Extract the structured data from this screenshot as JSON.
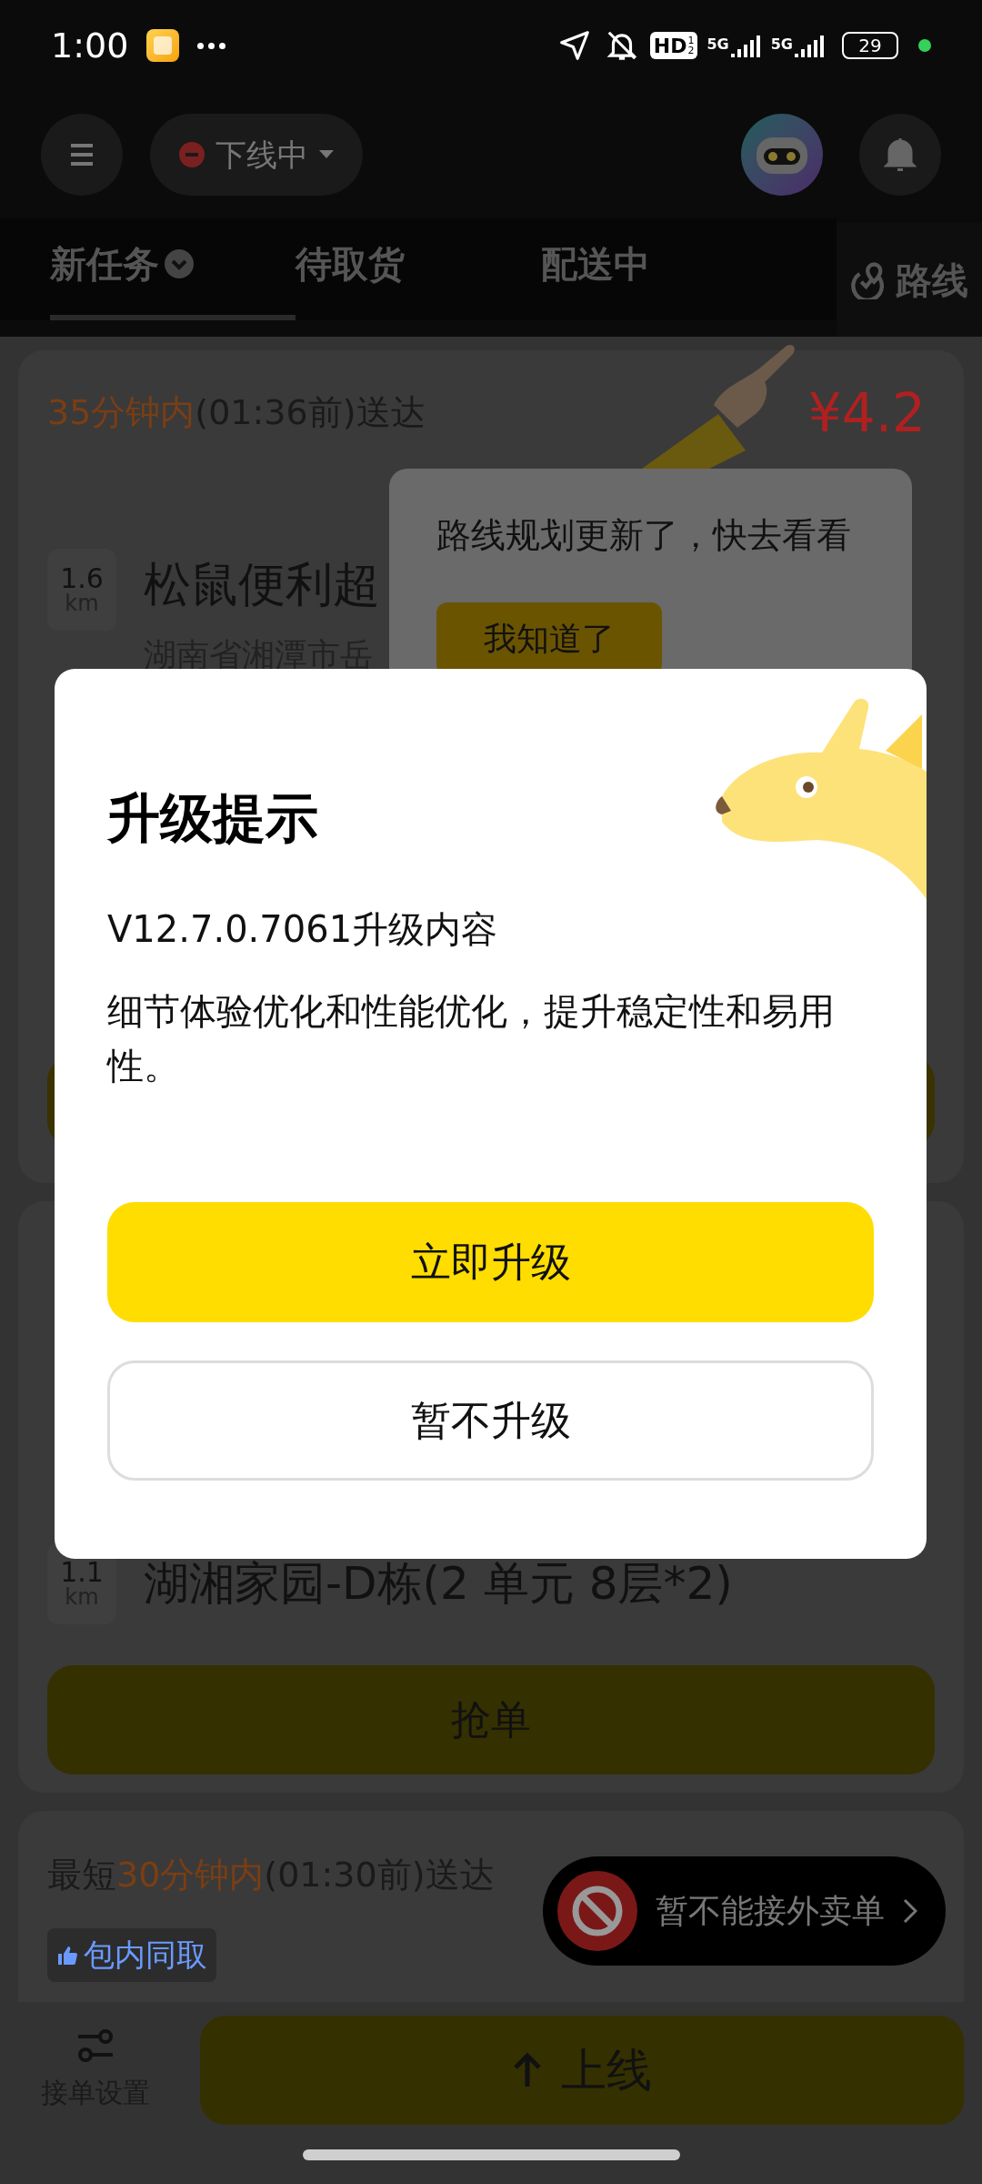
{
  "status_bar": {
    "time": "1:00",
    "hd_badge": "HD",
    "hd_sims": [
      "1",
      "2"
    ],
    "networks": [
      "5G",
      "5G"
    ],
    "battery": "29"
  },
  "header": {
    "status": "下线中"
  },
  "tabs": [
    {
      "label": "新任务",
      "selected": true
    },
    {
      "label": "待取货",
      "selected": false
    },
    {
      "label": "配送中",
      "selected": false
    }
  ],
  "route_button": "路线",
  "orders": [
    {
      "deadline_highlight": "35分钟内",
      "deadline_rest": "(01:36前)送达",
      "price": "¥4.2",
      "distance": "1.6",
      "distance_unit": "km",
      "place": "松鼠便利超",
      "address": "湖南省湘潭市岳"
    },
    {
      "distance": "1.1",
      "distance_unit": "km",
      "place": "湖湘家园-D栋(2 单元 8层*2)",
      "grab_button": "抢单"
    },
    {
      "deadline_prefix": "最短",
      "deadline_highlight": "30分钟内",
      "deadline_rest": "(01:30前)送达",
      "tag": "包内同取"
    }
  ],
  "tooltip": {
    "text": "路线规划更新了，快去看看",
    "button": "我知道了"
  },
  "dialog": {
    "title": "升级提示",
    "version_line": "V12.7.0.7061升级内容",
    "body": "细节体验优化和性能优化，提升稳定性和易用性。",
    "primary_button": "立即升级",
    "secondary_button": "暂不升级"
  },
  "toast": {
    "text": "暂不能接外卖单"
  },
  "bottom_bar": {
    "settings_label": "接单设置",
    "online_button": "上线"
  }
}
